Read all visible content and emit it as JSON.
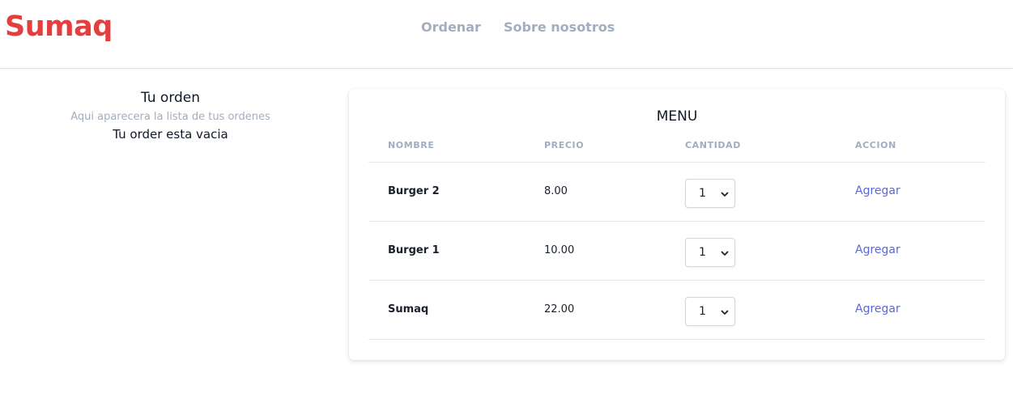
{
  "header": {
    "brand": "Sumaq",
    "nav": [
      {
        "label": "Ordenar"
      },
      {
        "label": "Sobre nosotros"
      }
    ]
  },
  "order": {
    "title": "Tu orden",
    "subtitle": "Aqui aparecera la lista de tus ordenes",
    "empty": "Tu order esta vacia"
  },
  "menu": {
    "title": "MENU",
    "columns": [
      "NOMBRE",
      "PRECIO",
      "CANTIDAD",
      "ACCION"
    ],
    "rows": [
      {
        "name": "Burger 2",
        "price": "8.00",
        "quantity": "1",
        "action": "Agregar"
      },
      {
        "name": "Burger 1",
        "price": "10.00",
        "quantity": "1",
        "action": "Agregar"
      },
      {
        "name": "Sumaq",
        "price": "22.00",
        "quantity": "1",
        "action": "Agregar"
      }
    ]
  },
  "colors": {
    "brand": "#e53e3e",
    "nav": "#a0aec0",
    "link": "#5a67d8"
  }
}
